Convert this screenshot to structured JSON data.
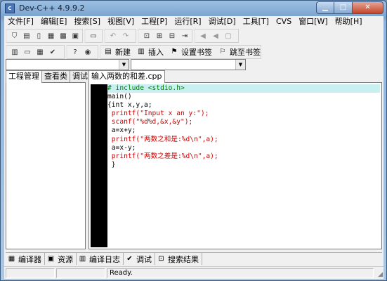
{
  "window": {
    "title": "Dev-C++ 4.9.9.2",
    "buttons": [
      "▁",
      "□",
      "✕"
    ]
  },
  "menu": [
    "文件[F]",
    "编辑[E]",
    "搜索[S]",
    "视图[V]",
    "工程[P]",
    "运行[R]",
    "调试[D]",
    "工具[T]",
    "CVS",
    "窗口[W]",
    "帮助[H]"
  ],
  "toolbar2": {
    "new_label": "新建",
    "insert_label": "插入",
    "set_bookmark_label": "设置书签",
    "goto_bookmark_label": "跳至书签"
  },
  "combos": {
    "class_combo": "",
    "member_combo": ""
  },
  "left_tabs": [
    "工程管理",
    "查看类",
    "调试"
  ],
  "editor_tab": "输入两数的和差.cpp",
  "code": {
    "lines": [
      "# include <stdio.h>",
      "main()",
      "{int x,y,a;",
      " printf(\"Input x an y:\");",
      " scanf(\"%d%d,&x,&y\");",
      " a=x+y;",
      " printf(\"两数之和是:%d\\n\",a);",
      " a=x-y;",
      " printf(\"两数之差是:%d\\n\",a);",
      " }"
    ]
  },
  "bottom_tabs": [
    "编译器",
    "资源",
    "编译日志",
    "调试",
    "搜索结果"
  ],
  "status": {
    "left": "",
    "middle": "",
    "right": "Ready."
  },
  "icons": {
    "toolbar1": [
      "open-project-icon",
      "open-file-icon",
      "new-file-icon",
      "save-icon",
      "save-all-icon",
      "close-icon",
      "print-icon",
      "undo-icon",
      "redo-icon",
      "find-icon",
      "replace-icon",
      "find-next-icon",
      "goto-line-icon",
      "indent-icon",
      "unindent-icon",
      "toggle-comment-icon"
    ],
    "toolbar2": [
      "layout-icon",
      "window-icon",
      "grid-icon",
      "check-icon",
      "help-icon",
      "about-icon"
    ]
  },
  "colors": {
    "title_gradient_top": "#9cc0e4",
    "current_line": "#c8f0f0",
    "directive": "#008000",
    "string": "#cc0000",
    "gutter": "#000000"
  }
}
